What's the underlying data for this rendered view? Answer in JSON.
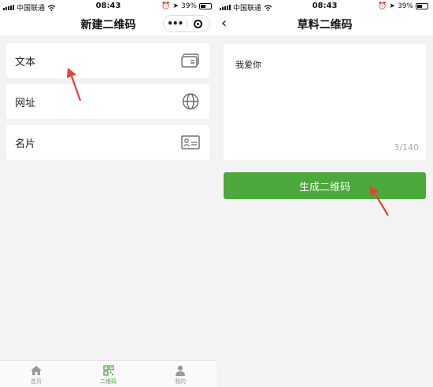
{
  "status_bar": {
    "left": {
      "carrier": "中国联通",
      "time": "08:43",
      "battery": "39%"
    },
    "right": {
      "carrier": "中国联通",
      "time": "08:43",
      "battery": "39%"
    }
  },
  "left_screen": {
    "title": "新建二维码",
    "items": [
      {
        "label": "文本",
        "icon": "text-card-icon"
      },
      {
        "label": "网址",
        "icon": "globe-icon"
      },
      {
        "label": "名片",
        "icon": "id-card-icon"
      }
    ],
    "tabs": [
      {
        "label": "首页",
        "icon": "home-icon",
        "active": false
      },
      {
        "label": "二维码",
        "icon": "qr-code-icon",
        "active": true
      },
      {
        "label": "我的",
        "icon": "user-icon",
        "active": false
      }
    ]
  },
  "right_screen": {
    "title": "草料二维码",
    "input_text": "我爱你",
    "char_count": "3/140",
    "generate_label": "生成二维码"
  },
  "colors": {
    "accent_green": "#4ba83b",
    "annotation_red": "#e0443a"
  }
}
